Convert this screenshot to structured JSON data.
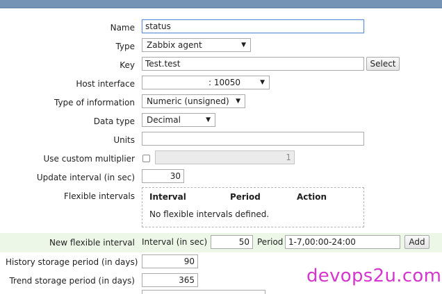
{
  "form": {
    "name": {
      "label": "Name",
      "value": "status"
    },
    "type": {
      "label": "Type",
      "value": "Zabbix agent"
    },
    "key": {
      "label": "Key",
      "value": "Test.test",
      "button": "Select"
    },
    "host_interface": {
      "label": "Host interface",
      "value": ": 10050"
    },
    "type_of_information": {
      "label": "Type of information",
      "value": "Numeric (unsigned)"
    },
    "data_type": {
      "label": "Data type",
      "value": "Decimal"
    },
    "units": {
      "label": "Units",
      "value": ""
    },
    "custom_multiplier": {
      "label": "Use custom multiplier",
      "checked": false,
      "value": "1"
    },
    "update_interval": {
      "label": "Update interval (in sec)",
      "value": "30"
    },
    "flexible_intervals": {
      "label": "Flexible intervals",
      "columns": [
        "Interval",
        "Period",
        "Action"
      ],
      "empty_text": "No flexible intervals defined."
    },
    "new_flexible_interval": {
      "label": "New flexible interval",
      "interval_label": "Interval (in sec)",
      "interval_value": "50",
      "period_label": "Period",
      "period_value": "1-7,00:00-24:00",
      "add_button": "Add"
    },
    "history_storage": {
      "label": "History storage period (in days)",
      "value": "90"
    },
    "trend_storage": {
      "label": "Trend storage period (in days)",
      "value": "365"
    }
  },
  "watermark": "devops2u.com",
  "colors": {
    "header_bar": "#7593b5",
    "highlight_row": "#edf7e8",
    "watermark": "#d636cf"
  }
}
